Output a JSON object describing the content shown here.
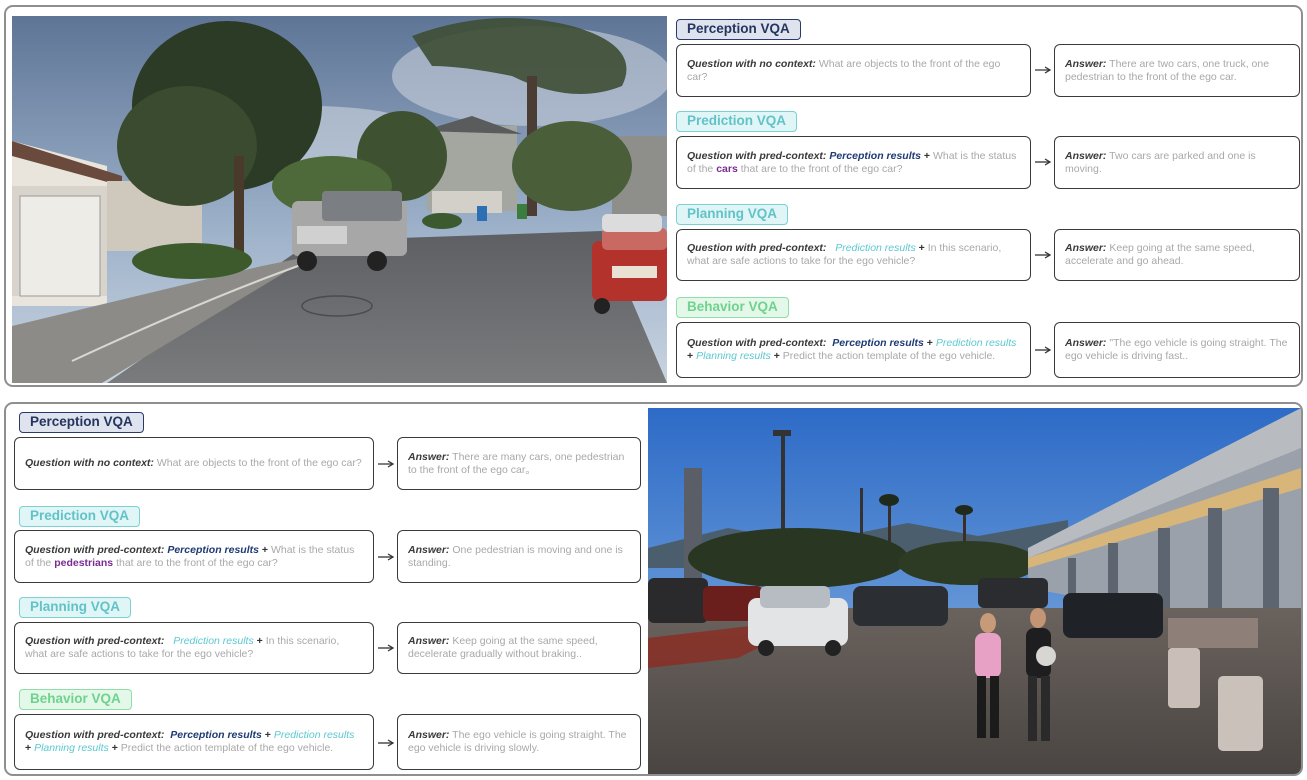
{
  "colors": {
    "perception": "#24355f",
    "prediction": "#62c2c8",
    "planning": "#62c2c8",
    "behavior": "#6fd28d",
    "highlight": "#7a2d8f",
    "box_border": "#3a3a3a",
    "panel_border": "#8f8f8f"
  },
  "panel1": {
    "perception": {
      "tag": "Perception VQA",
      "q_lead": "Question with no context:",
      "q_text": " What are objects to the front of the ego car?",
      "a_lead": "Answer:",
      "a_text": " There are two cars, one truck, one pedestrian to the front of the ego car."
    },
    "prediction": {
      "tag": "Prediction VQA",
      "q_lead": "Question with pred-context:",
      "q_ref": "Perception results",
      "plus": " + ",
      "q_pre": "What is the status of the ",
      "q_highlight": "cars",
      "q_post": " that are to the front of the ego car?",
      "a_lead": "Answer:",
      "a_text": " Two cars are parked and one is moving."
    },
    "planning": {
      "tag": "Planning VQA",
      "q_lead": "Question with pred-context:",
      "q_ref": "Prediction results",
      "plus": " + ",
      "q_text": "In this scenario, what are safe actions to take for the ego vehicle?",
      "a_lead": "Answer:",
      "a_text": " Keep going at the same speed, accelerate and go ahead."
    },
    "behavior": {
      "tag": "Behavior  VQA",
      "q_lead": "Question with pred-context:",
      "q_ref1": "Perception results",
      "plus1": " + ",
      "q_ref2": "Prediction results",
      "plus2": " + ",
      "q_ref3": "Planning results",
      "plus3": " + ",
      "q_text": "Predict the action template of the ego vehicle.",
      "a_lead": "Answer:",
      "a_text": " \"The ego vehicle is going straight. The ego vehicle is driving fast.."
    }
  },
  "panel2": {
    "perception": {
      "tag": "Perception VQA",
      "q_lead": "Question with no context:",
      "q_text": " What are objects to the front of the ego car?",
      "a_lead": "Answer:",
      "a_text": " There are many cars, one pedestrian to the front of the ego car。"
    },
    "prediction": {
      "tag": "Prediction VQA",
      "q_lead": "Question with pred-context:",
      "q_ref": "Perception results",
      "plus": " + ",
      "q_pre": "What is the status of the ",
      "q_highlight": "pedestrians",
      "q_post": " that are to the front of the ego car?",
      "a_lead": "Answer:",
      "a_text": " One pedestrian is moving and one is standing."
    },
    "planning": {
      "tag": "Planning VQA",
      "q_lead": "Question with pred-context:",
      "q_ref": "Prediction results",
      "plus": " + ",
      "q_text": "In this scenario, what are safe actions to take for the ego vehicle?",
      "a_lead": "Answer:",
      "a_text": " Keep going at the same speed, decelerate gradually without braking.."
    },
    "behavior": {
      "tag": "Behavior VQA",
      "q_lead": "Question with pred-context:",
      "q_ref1": "Perception results",
      "plus1": " + ",
      "q_ref2": "Prediction results",
      "plus2": " + ",
      "q_ref3": "Planning results",
      "plus3": " + ",
      "q_text": "Predict the action template of the ego vehicle.",
      "a_lead": "Answer:",
      "a_text": " The ego vehicle is going straight. The ego vehicle is driving slowly."
    }
  }
}
